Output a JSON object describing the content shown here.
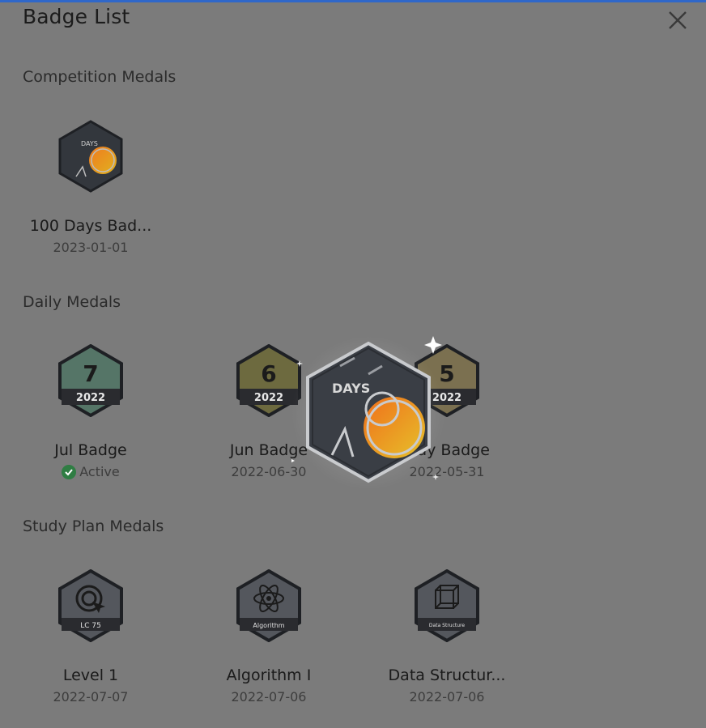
{
  "window": {
    "title": "Badge List",
    "accent": "#2f67c9"
  },
  "sections": [
    {
      "title": "Competition Medals"
    },
    {
      "title": "Daily Medals"
    },
    {
      "title": "Study Plan Medals"
    }
  ],
  "competition": [
    {
      "name": "100 Days Bad...",
      "date": "2023-01-01",
      "icon": "100-days-badge-icon",
      "label": "DAYS"
    }
  ],
  "daily": [
    {
      "name": "Jul Badge",
      "status": "Active",
      "icon": "jul-badge-icon",
      "number": "7",
      "year": "2022",
      "color": "#557567"
    },
    {
      "name": "Jun Badge",
      "date": "2022-06-30",
      "icon": "jun-badge-icon",
      "number": "6",
      "year": "2022",
      "color": "#6d6a3f"
    },
    {
      "name": "May Badge",
      "date": "2022-05-31",
      "icon": "may-badge-icon",
      "number": "5",
      "year": "2022",
      "color": "#7b7050"
    }
  ],
  "study": [
    {
      "name": "Level 1",
      "date": "2022-07-07",
      "icon": "target-icon",
      "label": "LC 75"
    },
    {
      "name": "Algorithm I",
      "date": "2022-07-06",
      "icon": "atom-icon",
      "label": "Algorithm"
    },
    {
      "name": "Data Structur...",
      "date": "2022-07-06",
      "icon": "cube-icon",
      "label": "Data Structure"
    }
  ],
  "overlay": {
    "icon": "100-days-badge-large-icon",
    "label": "DAYS"
  }
}
